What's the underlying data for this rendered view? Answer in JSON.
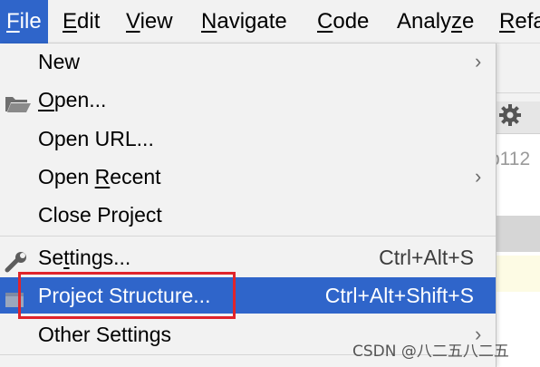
{
  "menubar": [
    {
      "name": "file",
      "prefix": "",
      "mnemonic": "F",
      "suffix": "ile",
      "active": true
    },
    {
      "name": "edit",
      "prefix": "",
      "mnemonic": "E",
      "suffix": "dit"
    },
    {
      "name": "view",
      "prefix": "",
      "mnemonic": "V",
      "suffix": "iew"
    },
    {
      "name": "navigate",
      "prefix": "",
      "mnemonic": "N",
      "suffix": "avigate"
    },
    {
      "name": "code",
      "prefix": "",
      "mnemonic": "C",
      "suffix": "ode"
    },
    {
      "name": "analyze",
      "prefix": "Analy",
      "mnemonic": "z",
      "suffix": "e"
    },
    {
      "name": "refactor",
      "prefix": "",
      "mnemonic": "R",
      "suffix": "efa"
    }
  ],
  "background": {
    "text": "b112",
    "gear_icon": "gear-icon"
  },
  "menu": {
    "new": {
      "label": "New",
      "submenu": true
    },
    "open": {
      "prefix": "",
      "mnemonic": "O",
      "suffix": "pen...",
      "icon": "folder-open-icon"
    },
    "open_url": {
      "label": "Open URL..."
    },
    "open_recent": {
      "prefix": "Open ",
      "mnemonic": "R",
      "suffix": "ecent",
      "submenu": true
    },
    "close_project": {
      "label": "Close Project"
    },
    "settings": {
      "prefix": "Se",
      "mnemonic": "t",
      "suffix": "tings...",
      "shortcut": "Ctrl+Alt+S",
      "icon": "wrench-icon"
    },
    "project_structure": {
      "label": "Project Structure...",
      "shortcut": "Ctrl+Alt+Shift+S",
      "icon": "project-structure-icon",
      "selected": true
    },
    "other_settings": {
      "label": "Other Settings",
      "submenu": true
    },
    "arrow_glyph": "›"
  },
  "watermark": "CSDN @八二五八二五",
  "colors": {
    "selection": "#2f65ca",
    "highlight_box": "#e0242b",
    "menu_bg": "#f2f2f2"
  }
}
